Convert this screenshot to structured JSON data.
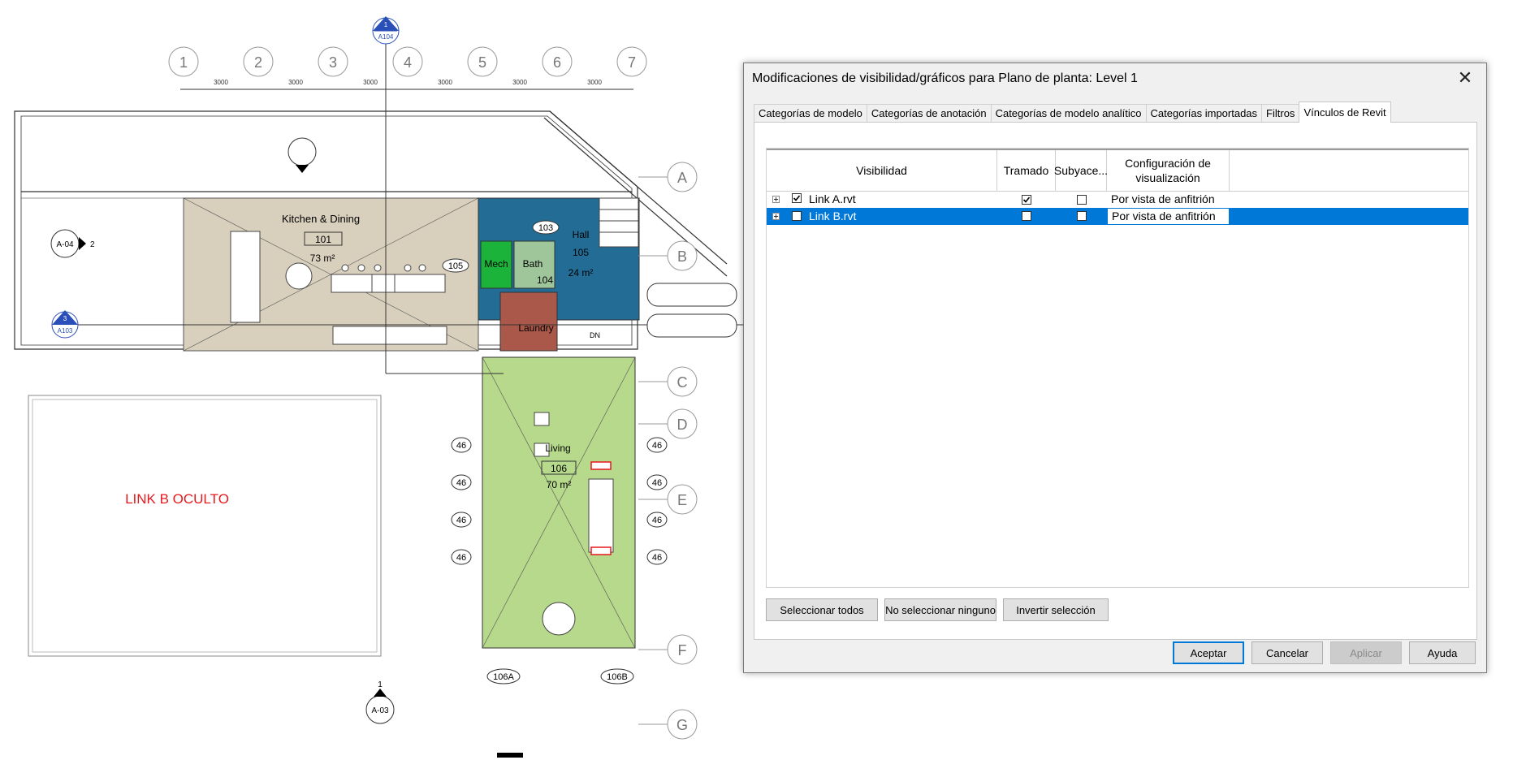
{
  "dialog": {
    "title": "Modificaciones de visibilidad/gráficos para Plano de planta: Level 1",
    "close_glyph": "✕",
    "tabs": [
      {
        "label": "Categorías de modelo"
      },
      {
        "label": "Categorías de anotación"
      },
      {
        "label": "Categorías de modelo analítico"
      },
      {
        "label": "Categorías importadas"
      },
      {
        "label": "Filtros"
      },
      {
        "label": "Vínculos de Revit",
        "active": true
      }
    ],
    "columns": {
      "visibility": "Visibilidad",
      "halftone": "Tramado",
      "underlay": "Subyace...",
      "display_settings_1": "Configuración de",
      "display_settings_2": "visualización"
    },
    "rows": [
      {
        "name": "Link A.rvt",
        "visible": true,
        "halftone": true,
        "underlay": false,
        "display": "Por vista de anfitrión",
        "selected": false
      },
      {
        "name": "Link B.rvt",
        "visible": false,
        "halftone": false,
        "underlay": false,
        "display": "Por vista de anfitrión",
        "selected": true
      }
    ],
    "buttons": {
      "select_all": "Seleccionar todos",
      "select_none": "No seleccionar ninguno",
      "invert": "Invertir selección",
      "ok": "Aceptar",
      "cancel": "Cancelar",
      "apply": "Aplicar",
      "help": "Ayuda"
    }
  },
  "plan": {
    "grid_columns": [
      "1",
      "2",
      "3",
      "4",
      "5",
      "6",
      "7"
    ],
    "grid_rows": [
      "A",
      "B",
      "C",
      "D",
      "E",
      "F",
      "G"
    ],
    "dimension": "3000",
    "rooms": [
      {
        "name": "Kitchen & Dining",
        "number": "101",
        "area": "73 m²"
      },
      {
        "name": "Hall",
        "number": "105",
        "area": "24 m²"
      },
      {
        "name": "Living",
        "number": "106",
        "area": "70 m²"
      },
      {
        "name": "Mech",
        "number": "",
        "area": ""
      },
      {
        "name": "Bath",
        "number": "104",
        "area": ""
      },
      {
        "name": "Laundry",
        "number": "",
        "area": ""
      }
    ],
    "tags": {
      "t103": "103",
      "t105": "105",
      "t106a": "106A",
      "t106b": "106B",
      "t46": "46",
      "dn": "DN"
    },
    "sections": {
      "top": {
        "num": "1",
        "sheet": "A104"
      },
      "left_upper": {
        "sheet": "A-04",
        "num": "2"
      },
      "left_lower": {
        "num": "3",
        "sheet": "A103"
      },
      "bottom": {
        "num": "1",
        "sheet": "A-03"
      }
    },
    "hidden_label": "LINK B OCULTO"
  },
  "colors": {
    "accent_blue": "#0078d7",
    "annotation_red": "#e8191c",
    "room_beige": "#d8d0bd",
    "room_blue": "#236c95",
    "room_green": "#b6d98b",
    "mech_green": "#1bb33a",
    "laundry_brown": "#a9584a"
  }
}
